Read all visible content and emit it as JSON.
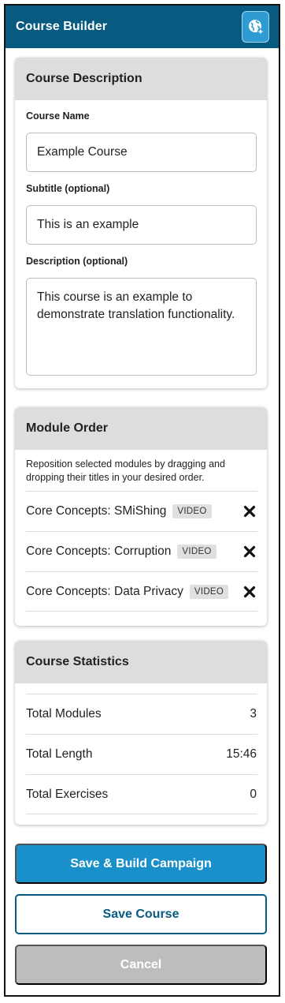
{
  "app": {
    "title": "Course Builder",
    "icon": "globe-plus-icon"
  },
  "description_section": {
    "title": "Course Description",
    "course_name_label": "Course Name",
    "course_name_value": "Example Course",
    "subtitle_label": "Subtitle (optional)",
    "subtitle_value": "This is an example",
    "description_label": "Description (optional)",
    "description_value": "This course is an example to demonstrate translation functionality."
  },
  "module_section": {
    "title": "Module Order",
    "hint": "Reposition selected modules by dragging and dropping their titles in your desired order.",
    "modules": [
      {
        "title": "Core Concepts: SMiShing",
        "badge": "VIDEO"
      },
      {
        "title": "Core Concepts: Corruption",
        "badge": "VIDEO"
      },
      {
        "title": "Core Concepts: Data Privacy",
        "badge": "VIDEO"
      }
    ]
  },
  "stats_section": {
    "title": "Course Statistics",
    "rows": [
      {
        "label": "Total Modules",
        "value": "3"
      },
      {
        "label": "Total Length",
        "value": "15:46"
      },
      {
        "label": "Total Exercises",
        "value": "0"
      }
    ]
  },
  "actions": {
    "save_build": "Save & Build Campaign",
    "save_course": "Save Course",
    "cancel": "Cancel"
  },
  "colors": {
    "header": "#075a80",
    "primary": "#1a90cb",
    "cancel": "#bdbdbd"
  }
}
